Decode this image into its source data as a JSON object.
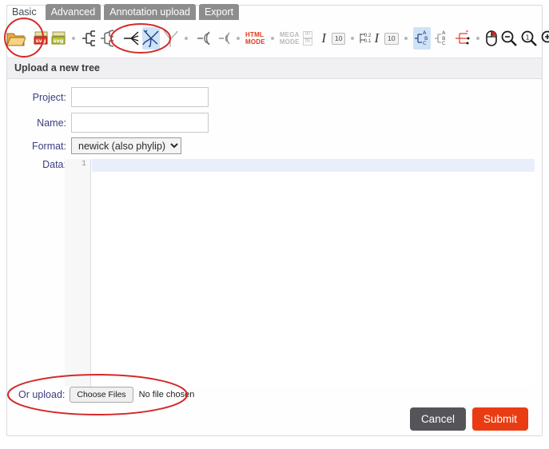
{
  "tabs": [
    {
      "label": "Basic",
      "active": true
    },
    {
      "label": "Advanced",
      "active": false
    },
    {
      "label": "Annotation upload",
      "active": false
    },
    {
      "label": "Export",
      "active": false
    }
  ],
  "toolbar": {
    "items": [
      {
        "name": "open-folder-icon",
        "kind": "icon"
      },
      {
        "name": "export-svg-red-icon",
        "label": "svg"
      },
      {
        "name": "export-svg-green-icon",
        "label": "svg"
      },
      {
        "name": "rectangular-tree-icon",
        "kind": "icon"
      },
      {
        "name": "slanted-tree-icon",
        "kind": "icon"
      },
      {
        "name": "unrooted-tree-left-icon",
        "kind": "icon"
      },
      {
        "name": "unrooted-tree-icon",
        "kind": "icon",
        "selected": true
      },
      {
        "name": "radial-tree-icon",
        "kind": "icon"
      },
      {
        "name": "circular-tree-icon",
        "kind": "icon"
      },
      {
        "name": "circular-tree-partial-icon",
        "kind": "icon"
      },
      {
        "name": "html-mode-toggle",
        "label_top": "HTML",
        "label_bottom": "MODE",
        "state": "on"
      },
      {
        "name": "mega-mode-toggle",
        "label_top": "MEGA",
        "label_bottom": "MODE",
        "state": "off",
        "badge_top": "90",
        "badge_bottom": "95"
      },
      {
        "name": "leaf-font-style-italic",
        "label": "I"
      },
      {
        "name": "leaf-font-size",
        "value": "10"
      },
      {
        "name": "branch-length-toggle",
        "label_top": "0.2",
        "label_bottom": "0.1"
      },
      {
        "name": "branch-font-style-italic",
        "label": "I"
      },
      {
        "name": "branch-font-size",
        "value": "10"
      },
      {
        "name": "align-labels-icon",
        "kind": "icon",
        "selected": true
      },
      {
        "name": "unalign-labels-icon",
        "kind": "icon"
      },
      {
        "name": "bootstrap-display-icon",
        "kind": "icon"
      },
      {
        "name": "mouse-mode-icon",
        "kind": "icon"
      },
      {
        "name": "zoom-out-icon",
        "kind": "icon"
      },
      {
        "name": "zoom-reset-icon",
        "kind": "icon",
        "label": "1"
      },
      {
        "name": "zoom-in-icon",
        "kind": "icon"
      }
    ]
  },
  "panel": {
    "title": "Upload a new tree",
    "fields": {
      "project": {
        "label": "Project:",
        "value": "",
        "placeholder": ""
      },
      "name": {
        "label": "Name:",
        "value": "",
        "placeholder": ""
      },
      "format": {
        "label": "Format:",
        "selected": "newick (also phylip)",
        "options": [
          "newick (also phylip)"
        ]
      },
      "data": {
        "label": "Data:",
        "value": "",
        "line_number": "1"
      }
    },
    "upload": {
      "label": "Or upload:",
      "button": "Choose Files",
      "status": "No file chosen"
    },
    "actions": {
      "cancel": "Cancel",
      "submit": "Submit"
    }
  },
  "annotations": {
    "color": "#d42a2a",
    "marks": [
      {
        "name": "highlight-open-folder",
        "shape": "ellipse"
      },
      {
        "name": "highlight-tree-shape-icons",
        "shape": "ellipse"
      },
      {
        "name": "highlight-file-upload-row",
        "shape": "ellipse"
      }
    ]
  },
  "colors": {
    "tab_inactive_bg": "#8d8d8d",
    "submit_bg": "#ea3c12",
    "cancel_bg": "#555559",
    "label_text": "#3c3c80",
    "panel_head_bg": "#f0f0f3",
    "selected_tool_bg": "#cfe3f7",
    "annotation_red": "#d42a2a",
    "html_mode_on": "#e03a1c"
  }
}
